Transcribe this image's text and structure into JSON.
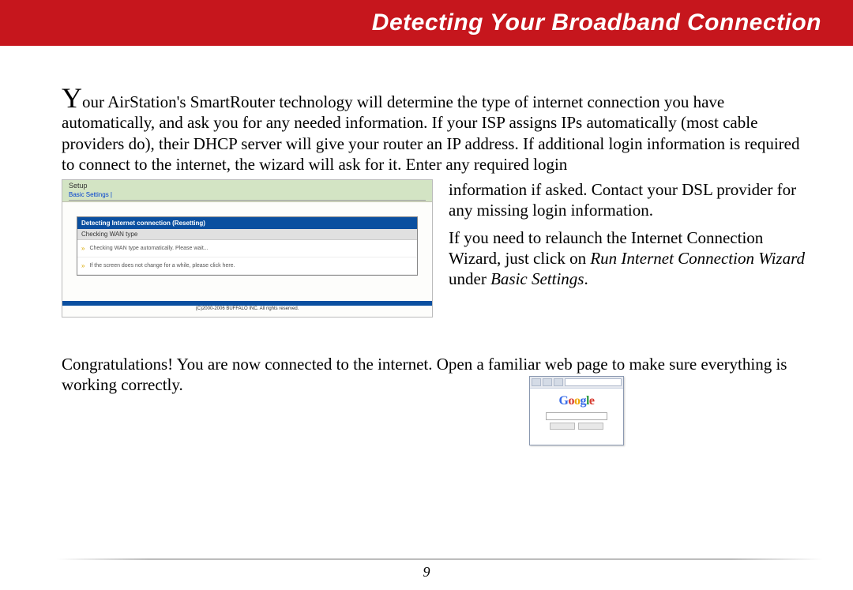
{
  "header": {
    "title": "Detecting Your Broadband Connection"
  },
  "body": {
    "dropcap": "Y",
    "para1_rest": "our AirStation's SmartRouter technology will determine the type of internet connection you have automatically, and ask you for any needed information.  If your ISP assigns IPs automatically (most cable providers do), their DHCP server will give your router an IP address.  If additional login information is required to connect to the internet, the wizard will ask for it.  Enter any required login ",
    "side_para_a": "information if asked.  Contact your DSL provider for any missing login information.",
    "side_para_b_pre": "If you need to relaunch the Internet Connection Wizard, just click on ",
    "side_para_b_em1": "Run Internet Connection Wizard",
    "side_para_b_mid": " under ",
    "side_para_b_em2": "Basic Settings",
    "side_para_b_post": ".",
    "para3": "Congratulations!  You are now connected to the internet.  Open a familiar web page to make sure everything is working correctly."
  },
  "wizard": {
    "tab": "Setup",
    "subtab": "Basic Settings  |",
    "panel_header": "Detecting Internet connection (Resetting)",
    "panel_sub": "Checking WAN type",
    "row1": "Checking WAN type automatically. Please wait...",
    "row2": "If the screen does not change for a while, please click here.",
    "footer": "(C)2000-2006 BUFFALO INC. All rights reserved."
  },
  "google": {
    "logo_chars": [
      "G",
      "o",
      "o",
      "g",
      "l",
      "e"
    ]
  },
  "page_number": "9"
}
